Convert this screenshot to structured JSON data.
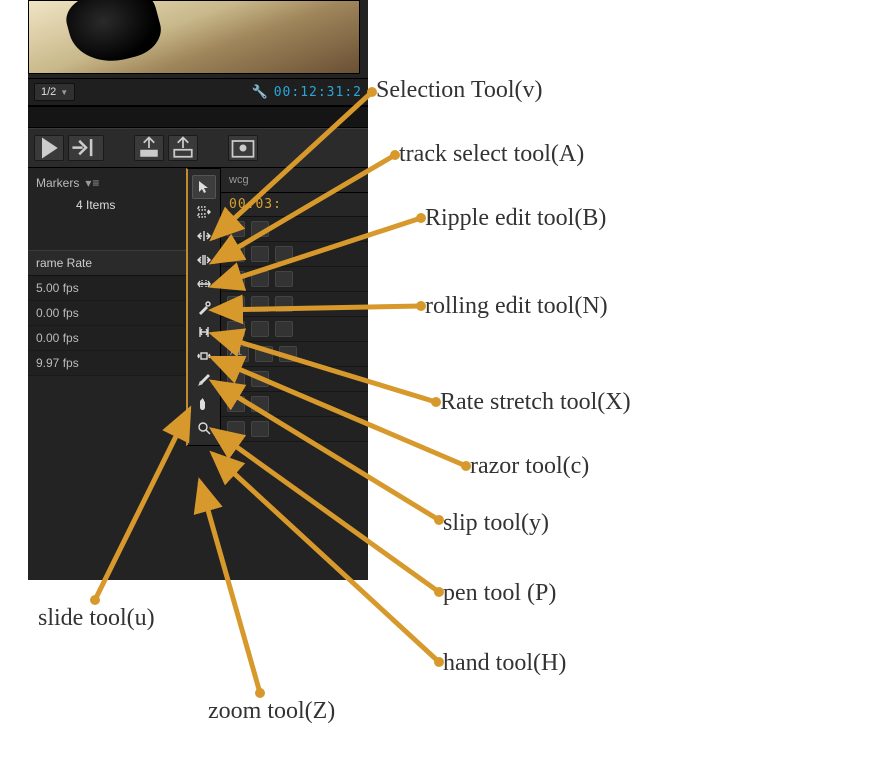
{
  "preview": {
    "resolution": "1/2",
    "timecode": "00:12:31:2"
  },
  "project": {
    "panel": "Markers",
    "items": "4 Items",
    "col_header": "rame Rate",
    "rows": [
      "5.00 fps",
      "0.00 fps",
      "0.00 fps",
      "9.97 fps"
    ]
  },
  "timeline": {
    "tab": "wcg",
    "time": "00:03:",
    "a1": "A1"
  },
  "labels": {
    "selection": "Selection Tool(v)",
    "track_select": "track select tool(A)",
    "ripple": "Ripple edit tool(B)",
    "rolling": "rolling edit tool(N)",
    "rate_stretch": "Rate stretch tool(X)",
    "razor": "razor tool(c)",
    "slip": "slip tool(y)",
    "pen": "pen tool (P)",
    "hand": "hand tool(H)",
    "slide": "slide tool(u)",
    "zoom": "zoom tool(Z)"
  }
}
